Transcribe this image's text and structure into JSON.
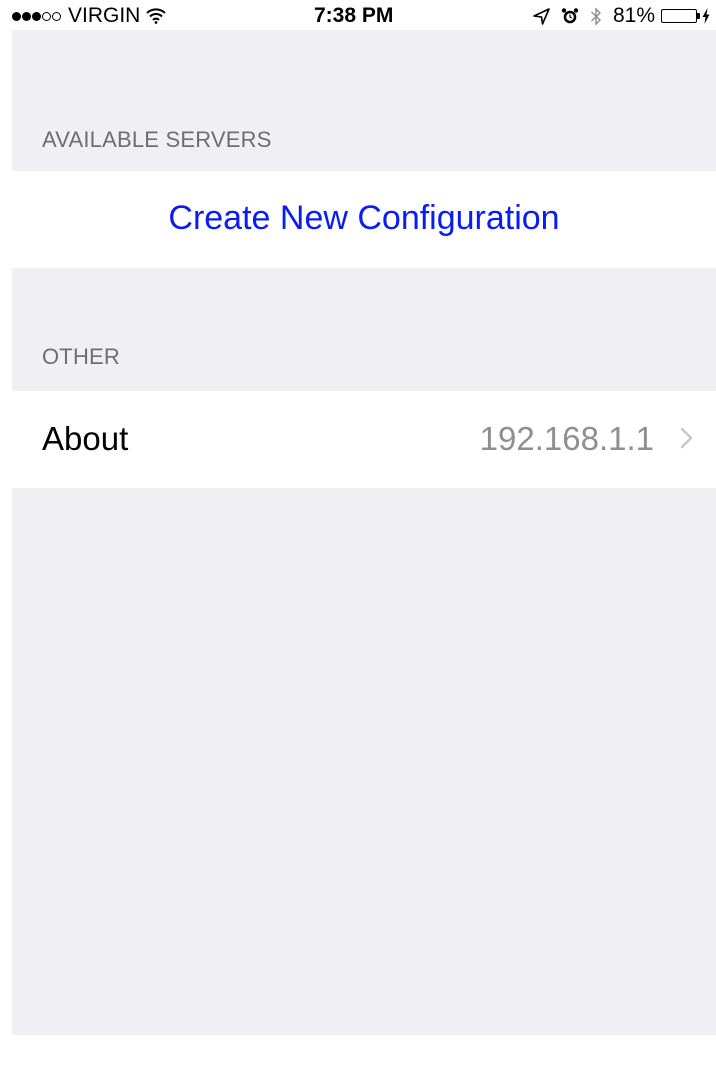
{
  "status_bar": {
    "carrier": "VIRGIN",
    "time": "7:38 PM",
    "battery_percent": "81%",
    "battery_level": 0.81,
    "signal_bars_filled": 3,
    "signal_bars_total": 5,
    "icons": [
      "wifi-icon",
      "location-icon",
      "alarm-icon",
      "bluetooth-icon",
      "battery-icon",
      "charging-icon"
    ]
  },
  "sections": {
    "available_servers": {
      "header": "AVAILABLE SERVERS",
      "create_label": "Create New Configuration"
    },
    "other": {
      "header": "OTHER",
      "about_label": "About",
      "about_detail": "192.168.1.1"
    }
  },
  "colors": {
    "background": "#efeff4",
    "header_text": "#6d6d72",
    "action_blue": "#0a1cf4",
    "detail_gray": "#8e8e93",
    "battery_green": "#4cd964"
  }
}
